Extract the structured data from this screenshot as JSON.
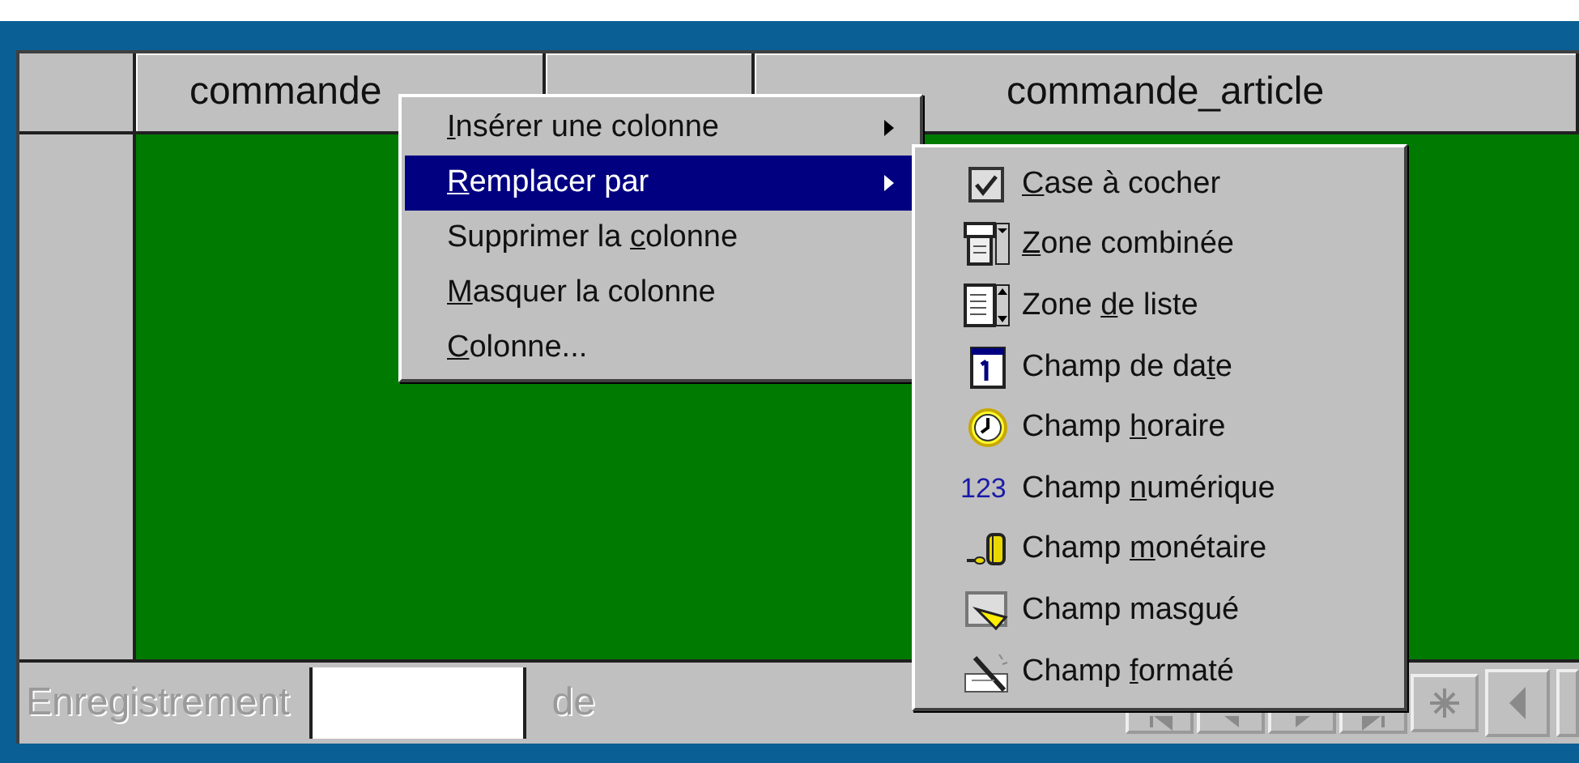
{
  "datasheet": {
    "columns": [
      {
        "label": "commande"
      },
      {
        "label": "commande_article"
      }
    ]
  },
  "context_menu": {
    "items": [
      {
        "key": "I",
        "after": "nsérer une colonne",
        "submenu": true,
        "selected": false
      },
      {
        "key": "R",
        "after": "emplacer par",
        "submenu": true,
        "selected": true
      },
      {
        "before": "Supprimer la ",
        "key": "c",
        "after": "olonne",
        "submenu": false,
        "selected": false
      },
      {
        "key": "M",
        "after": "asquer la colonne",
        "submenu": false,
        "selected": false
      },
      {
        "key": "C",
        "after": "olonne...",
        "submenu": false,
        "selected": false
      }
    ]
  },
  "submenu": {
    "items": [
      {
        "kind": "checkbox",
        "key": "C",
        "after": "ase à cocher"
      },
      {
        "kind": "combo",
        "key": "Z",
        "after": "one combinée"
      },
      {
        "kind": "list",
        "before": "Zone ",
        "key": "d",
        "after": "e liste"
      },
      {
        "kind": "date",
        "before": "Champ de da",
        "key": "t",
        "after": "e"
      },
      {
        "kind": "time",
        "before": "Champ ",
        "key": "h",
        "after": "oraire"
      },
      {
        "kind": "number",
        "icon_text": "123",
        "before": "Champ ",
        "key": "n",
        "after": "umérique"
      },
      {
        "kind": "currency",
        "before": "Champ ",
        "key": "m",
        "after": "onétaire"
      },
      {
        "kind": "masked",
        "before": "Champ masgué"
      },
      {
        "kind": "formatted",
        "before": "Champ ",
        "key": "f",
        "after": "ormaté"
      }
    ]
  },
  "record_bar": {
    "label": "Enregistrement",
    "of_label": "de",
    "disabled": true
  }
}
